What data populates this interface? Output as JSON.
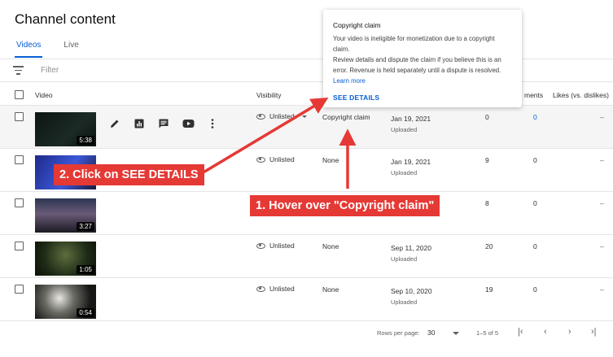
{
  "page": {
    "title": "Channel content"
  },
  "tabs": [
    {
      "label": "Videos",
      "active": true
    },
    {
      "label": "Live",
      "active": false
    }
  ],
  "filter": {
    "placeholder": "Filter"
  },
  "columns": {
    "video": "Video",
    "visibility": "Visibility",
    "comments": "ments",
    "likes": "Likes (vs. dislikes)"
  },
  "rows": [
    {
      "duration": "5:38",
      "visibility": "Unlisted",
      "restrictions": "Copyright claim",
      "date": "Jan 19, 2021",
      "date_status": "Uploaded",
      "views": "0",
      "comments": "0",
      "likes": "–",
      "thumb_color": "#0e1a17"
    },
    {
      "duration": "",
      "visibility": "Unlisted",
      "restrictions": "None",
      "date": "Jan 19, 2021",
      "date_status": "Uploaded",
      "views": "9",
      "comments": "0",
      "likes": "–",
      "thumb_color": "#2a3fb0"
    },
    {
      "duration": "3:27",
      "visibility": "",
      "restrictions": "",
      "date": "",
      "date_status": "",
      "views": "8",
      "comments": "0",
      "likes": "–",
      "thumb_color": "#2b3550"
    },
    {
      "duration": "1:05",
      "visibility": "Unlisted",
      "restrictions": "None",
      "date": "Sep 11, 2020",
      "date_status": "Uploaded",
      "views": "20",
      "comments": "0",
      "likes": "–",
      "thumb_color": "#26331c"
    },
    {
      "duration": "0:54",
      "visibility": "Unlisted",
      "restrictions": "None",
      "date": "Sep 10, 2020",
      "date_status": "Uploaded",
      "views": "19",
      "comments": "0",
      "likes": "–",
      "thumb_color": "#3a3a38"
    }
  ],
  "row_actions": [
    "edit-icon",
    "analytics-icon",
    "comments-icon",
    "youtube-icon",
    "more-icon"
  ],
  "tooltip": {
    "title": "Copyright claim",
    "line1": "Your video is ineligible for monetization due to a copyright claim.",
    "line2": "Review details and dispute the claim if you believe this is an error. Revenue is held separately until a dispute is resolved.",
    "learn_more": "Learn more",
    "action": "SEE DETAILS"
  },
  "footer": {
    "rows_per_page_label": "Rows per page:",
    "rows_per_page": "30",
    "range": "1–5 of 5"
  },
  "callouts": {
    "step1": "1. Hover over \"Copyright claim\"",
    "step2": "2. Click on SEE DETAILS"
  },
  "colors": {
    "accent": "#065fd4",
    "callout": "#e53935"
  }
}
